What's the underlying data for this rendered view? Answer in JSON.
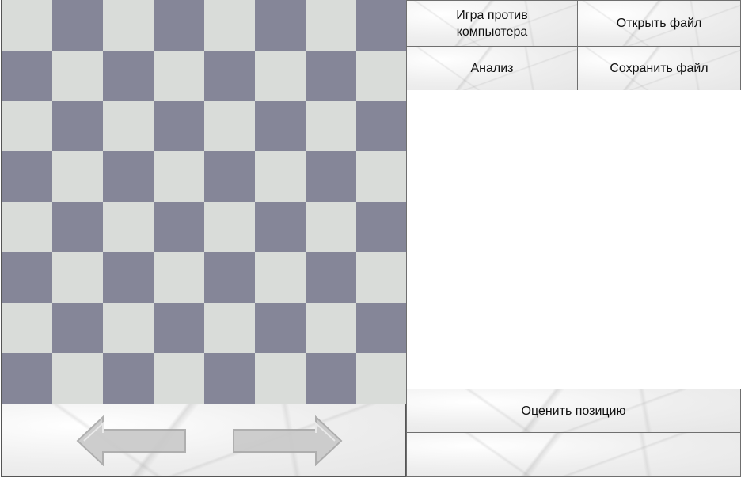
{
  "board": {
    "rows": 8,
    "cols": 8,
    "colors": {
      "light": "#d9dcd9",
      "dark": "#858698"
    }
  },
  "navigation": {
    "back_icon": "left-arrow-icon",
    "forward_icon": "right-arrow-icon"
  },
  "menu": {
    "vs_computer_line1": "Игра против",
    "vs_computer_line2": "компьютера",
    "open_file": "Открыть файл",
    "analysis": "Анализ",
    "save_file": "Сохранить файл"
  },
  "evaluate_position": "Оценить позицию"
}
